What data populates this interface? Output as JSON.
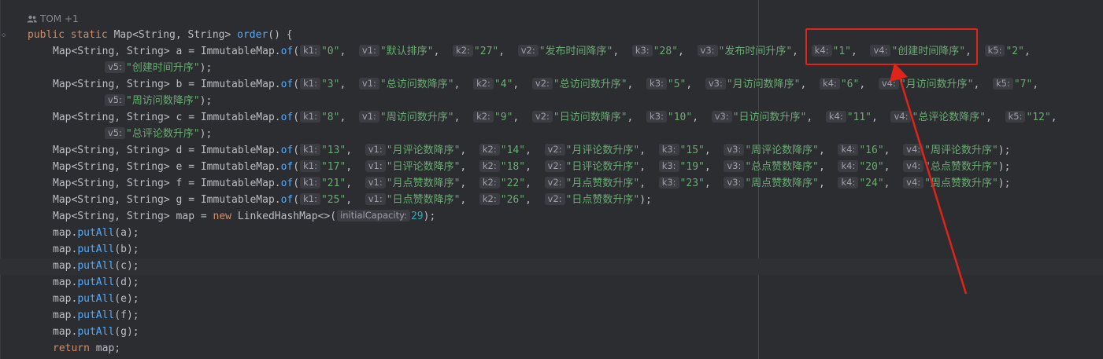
{
  "author": {
    "name": "TOM +1"
  },
  "code": {
    "signature": {
      "public": "public",
      "static": "static",
      "type": "Map<String, String>",
      "method": "order",
      "tail": "() {"
    },
    "maps": [
      {
        "var": "a",
        "lines": [
          [
            [
              "k1:",
              "\"0\""
            ],
            [
              "v1:",
              "\"默认排序\""
            ],
            [
              "k2:",
              "\"27\""
            ],
            [
              "v2:",
              "\"发布时间降序\""
            ],
            [
              "k3:",
              "\"28\""
            ],
            [
              "v3:",
              "\"发布时间升序\""
            ],
            [
              "k4:",
              "\"1\""
            ],
            [
              "v4:",
              "\"创建时间降序\""
            ],
            [
              "k5:",
              "\"2\""
            ]
          ],
          [
            [
              "v5:",
              "\"创建时间升序\""
            ]
          ]
        ]
      },
      {
        "var": "b",
        "lines": [
          [
            [
              "k1:",
              "\"3\""
            ],
            [
              "v1:",
              "\"总访问数降序\""
            ],
            [
              "k2:",
              "\"4\""
            ],
            [
              "v2:",
              "\"总访问数升序\""
            ],
            [
              "k3:",
              "\"5\""
            ],
            [
              "v3:",
              "\"月访问数降序\""
            ],
            [
              "k4:",
              "\"6\""
            ],
            [
              "v4:",
              "\"月访问数升序\""
            ],
            [
              "k5:",
              "\"7\""
            ]
          ],
          [
            [
              "v5:",
              "\"周访问数降序\""
            ]
          ]
        ]
      },
      {
        "var": "c",
        "lines": [
          [
            [
              "k1:",
              "\"8\""
            ],
            [
              "v1:",
              "\"周访问数升序\""
            ],
            [
              "k2:",
              "\"9\""
            ],
            [
              "v2:",
              "\"日访问数降序\""
            ],
            [
              "k3:",
              "\"10\""
            ],
            [
              "v3:",
              "\"日访问数升序\""
            ],
            [
              "k4:",
              "\"11\""
            ],
            [
              "v4:",
              "\"总评论数降序\""
            ],
            [
              "k5:",
              "\"12\""
            ]
          ],
          [
            [
              "v5:",
              "\"总评论数升序\""
            ]
          ]
        ]
      },
      {
        "var": "d",
        "lines": [
          [
            [
              "k1:",
              "\"13\""
            ],
            [
              "v1:",
              "\"月评论数降序\""
            ],
            [
              "k2:",
              "\"14\""
            ],
            [
              "v2:",
              "\"月评论数升序\""
            ],
            [
              "k3:",
              "\"15\""
            ],
            [
              "v3:",
              "\"周评论数降序\""
            ],
            [
              "k4:",
              "\"16\""
            ],
            [
              "v4:",
              "\"周评论数升序\""
            ]
          ]
        ]
      },
      {
        "var": "e",
        "lines": [
          [
            [
              "k1:",
              "\"17\""
            ],
            [
              "v1:",
              "\"日评论数降序\""
            ],
            [
              "k2:",
              "\"18\""
            ],
            [
              "v2:",
              "\"日评论数升序\""
            ],
            [
              "k3:",
              "\"19\""
            ],
            [
              "v3:",
              "\"总点赞数降序\""
            ],
            [
              "k4:",
              "\"20\""
            ],
            [
              "v4:",
              "\"总点赞数升序\""
            ]
          ]
        ]
      },
      {
        "var": "f",
        "lines": [
          [
            [
              "k1:",
              "\"21\""
            ],
            [
              "v1:",
              "\"月点赞数降序\""
            ],
            [
              "k2:",
              "\"22\""
            ],
            [
              "v2:",
              "\"月点赞数升序\""
            ],
            [
              "k3:",
              "\"23\""
            ],
            [
              "v3:",
              "\"周点赞数降序\""
            ],
            [
              "k4:",
              "\"24\""
            ],
            [
              "v4:",
              "\"周点赞数升序\""
            ]
          ]
        ]
      },
      {
        "var": "g",
        "lines": [
          [
            [
              "k1:",
              "\"25\""
            ],
            [
              "v1:",
              "\"日点赞数降序\""
            ],
            [
              "k2:",
              "\"26\""
            ],
            [
              "v2:",
              "\"日点赞数升序\""
            ]
          ]
        ]
      }
    ],
    "map_type": "Map<String, String>",
    "immutable_call": "ImmutableMap",
    "of": "of",
    "map_decl": {
      "var": "map",
      "new": "new",
      "class": "LinkedHashMap<>",
      "hint": "initialCapacity:",
      "arg": "29"
    },
    "put_calls": [
      "a",
      "b",
      "c",
      "d",
      "e",
      "f",
      "g"
    ],
    "put_method": "putAll",
    "return_kw": "return",
    "return_var": "map;"
  },
  "colors": {
    "annotation": "#e0241a"
  }
}
